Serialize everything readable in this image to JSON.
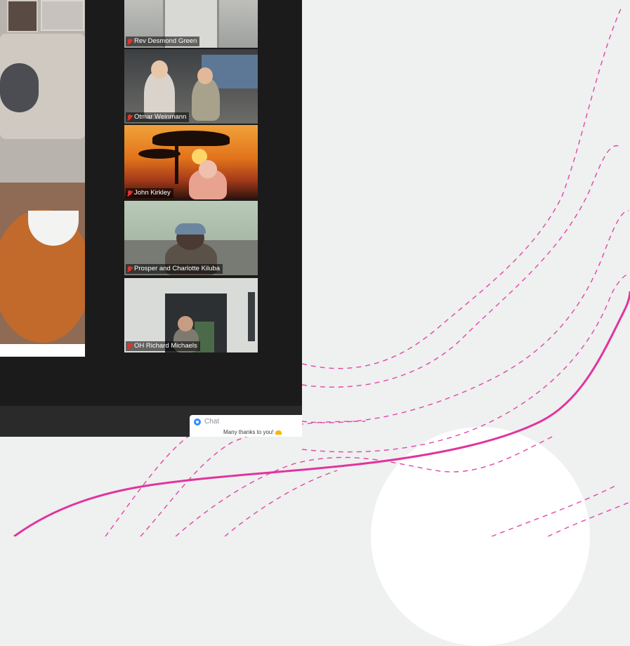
{
  "participants": [
    {
      "name": "Rev Desmond Green"
    },
    {
      "name": "Otmar Weinmann"
    },
    {
      "name": "John Kirkley"
    },
    {
      "name": "Prosper and Charlotte Kiluba"
    },
    {
      "name": "OH Richard Michaels"
    }
  ],
  "chat": {
    "title": "Chat",
    "message": "Many thanks to you!"
  },
  "icons": {
    "muted": "mic-muted-icon",
    "chat": "chat-bubble-icon"
  },
  "colors": {
    "accent_line": "#e0349e",
    "muted_icon": "#e0342e",
    "zoom_blue": "#2d8cff"
  }
}
